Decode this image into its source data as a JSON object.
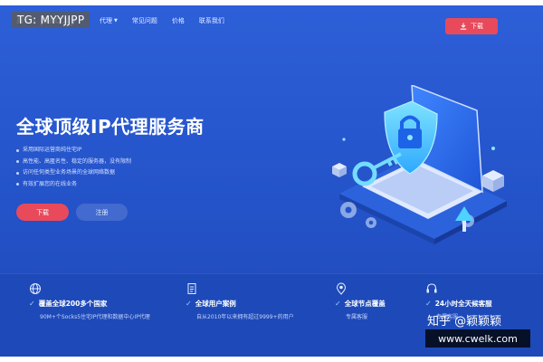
{
  "nav": {
    "links": [
      {
        "label": "代理",
        "has_caret": true
      },
      {
        "label": "常见问题"
      },
      {
        "label": "价格"
      },
      {
        "label": "联系我们"
      }
    ],
    "download_label": "下载"
  },
  "hero": {
    "title": "全球顶级IP代理服务商",
    "features": [
      "采用国际运营商纯住宅IP",
      "高性能、高匿名性、稳定的服务器，没有限制",
      "访问任何类型业务场景的全球网络数据",
      "有效扩展您的在线业务"
    ],
    "download_button": "下载",
    "register_button": "注册"
  },
  "strip": {
    "items": [
      {
        "title": "覆盖全球200多个国家",
        "subtitle": "90M+个Socks5住宅IP代理和数据中心IP代理",
        "icon": "globe-icon"
      },
      {
        "title": "全球用户案例",
        "subtitle": "自从2010年以来拥有超过9999+的用户",
        "icon": "document-icon"
      },
      {
        "title": "全球节点覆盖",
        "subtitle": "专属客服",
        "icon": "location-icon"
      },
      {
        "title": "24小时全天候客服",
        "subtitle": "专属客服",
        "icon": "headset-icon"
      }
    ]
  },
  "overlays": {
    "tg": "TG: MYYJJPP",
    "zhihu": "知乎 @颖颖颖",
    "cwelk": "www.cwelk.com"
  },
  "colors": {
    "background": "#2453c9",
    "accent_red": "#e84a5b",
    "illustration_cyan": "#5fd3ff"
  }
}
